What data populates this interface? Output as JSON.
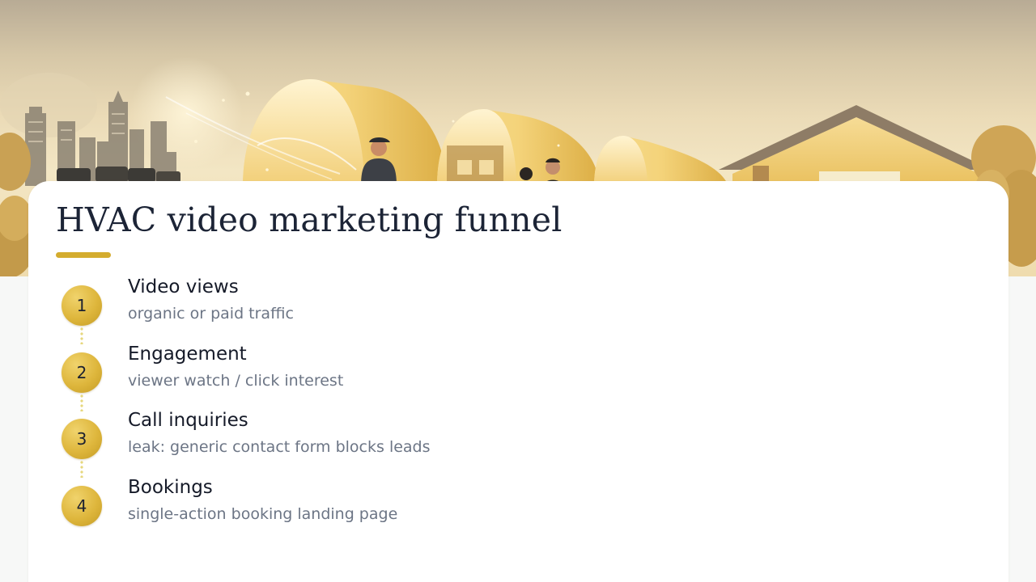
{
  "hero": {
    "illustration": "hvac-funnel-city-illustration"
  },
  "title": "HVAC video marketing funnel",
  "colors": {
    "accent": "#d4ac2e",
    "title_text": "#1c2436",
    "step_title_text": "#151a28",
    "step_sub_text": "#6c7585",
    "card_background": "#ffffff",
    "page_background": "#f7f8f7"
  },
  "steps": [
    {
      "number": "1",
      "title": "Video views",
      "subtitle": "organic or paid traffic"
    },
    {
      "number": "2",
      "title": "Engagement",
      "subtitle": "viewer watch / click interest"
    },
    {
      "number": "3",
      "title": "Call inquiries",
      "subtitle": "leak: generic contact form blocks leads"
    },
    {
      "number": "4",
      "title": "Bookings",
      "subtitle": "single-action booking landing page"
    }
  ]
}
